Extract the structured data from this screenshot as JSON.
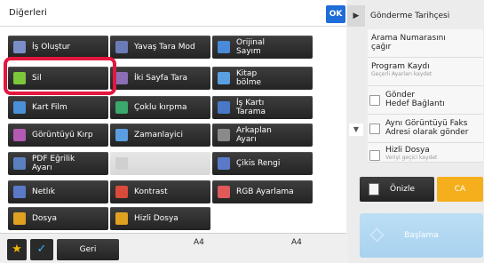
{
  "panel": {
    "title": "Diğerleri",
    "ok_label": "OK"
  },
  "functions": [
    {
      "label": "İş Oluştur",
      "icon": "job-build-icon",
      "icon_color": "#7a8fc8",
      "disabled": false
    },
    {
      "label": "Yavaş Tara Mod",
      "icon": "slow-scan-icon",
      "icon_color": "#6b7bb8",
      "disabled": false
    },
    {
      "label": "Orijinal\nSayım",
      "icon": "original-count-icon",
      "icon_color": "#4a8ad8",
      "disabled": false
    },
    {
      "label": "Sil",
      "icon": "erase-icon",
      "icon_color": "#7cc63a",
      "disabled": false,
      "selected": true
    },
    {
      "label": "İki Sayfa Tara",
      "icon": "two-page-scan-icon",
      "icon_color": "#8a6fb5",
      "disabled": false
    },
    {
      "label": "Kitap\nbölme",
      "icon": "book-divide-icon",
      "icon_color": "#5aa0e0",
      "disabled": false
    },
    {
      "label": "Kart Film",
      "icon": "card-film-icon",
      "icon_color": "#4a90d8",
      "disabled": false
    },
    {
      "label": "Çoklu kırpma",
      "icon": "multi-crop-icon",
      "icon_color": "#3aa86a",
      "disabled": false
    },
    {
      "label": "İş Kartı\nTarama",
      "icon": "business-card-icon",
      "icon_color": "#4a78c8",
      "disabled": false
    },
    {
      "label": "Görüntüyü Kırp",
      "icon": "image-crop-icon",
      "icon_color": "#b45ab5",
      "disabled": false
    },
    {
      "label": "Zamanlayici",
      "icon": "timer-icon",
      "icon_color": "#5a9de0",
      "disabled": false
    },
    {
      "label": "Arkaplan\nAyarı",
      "icon": "background-adjust-icon",
      "icon_color": "#8a8a8a",
      "disabled": false
    },
    {
      "label": "PDF Eğrilik\nAyarı",
      "icon": "pdf-skew-icon",
      "icon_color": "#5a80c0",
      "disabled": false
    },
    {
      "label": "",
      "icon": "disabled-icon",
      "icon_color": "#d0d0d0",
      "disabled": true
    },
    {
      "label": "Çikis Rengi",
      "icon": "output-color-icon",
      "icon_color": "#5a7ac8",
      "disabled": false
    },
    {
      "label": "Netlık",
      "icon": "sharpness-icon",
      "icon_color": "#5a7ac8",
      "disabled": false
    },
    {
      "label": "Kontrast",
      "icon": "contrast-icon",
      "icon_color": "#d84a3a",
      "disabled": false
    },
    {
      "label": "RGB Ayarlama",
      "icon": "rgb-adjust-icon",
      "icon_color": "#e05a5a",
      "disabled": false
    },
    {
      "label": "Dosya",
      "icon": "folder-icon",
      "icon_color": "#e0a020",
      "disabled": false
    },
    {
      "label": "Hizli Dosya",
      "icon": "quick-file-icon",
      "icon_color": "#e0a020",
      "disabled": false
    }
  ],
  "bottom": {
    "back_label": "Geri",
    "paper_left": "A4",
    "paper_right": "A4"
  },
  "history": {
    "title": "Gönderme Tarihçesi",
    "items": [
      {
        "label": "Arama Numarasını\nçağır",
        "sub": "",
        "check": false
      },
      {
        "label": "Program Kaydı",
        "sub": "Geçerli Ayarları kaydet",
        "check": false
      },
      {
        "label": "Gönder\nHedef Bağlantı",
        "sub": "",
        "check": true
      },
      {
        "label": "Aynı Görüntüyü Faks\nAdresi olarak gönder",
        "sub": "",
        "check": true
      },
      {
        "label": "Hizli Dosya",
        "sub": "Veriyi geçici kaydet",
        "check": true
      }
    ]
  },
  "actions": {
    "preview_label": "Önizle",
    "ca_label": "CA",
    "start_label": "Başlama"
  }
}
